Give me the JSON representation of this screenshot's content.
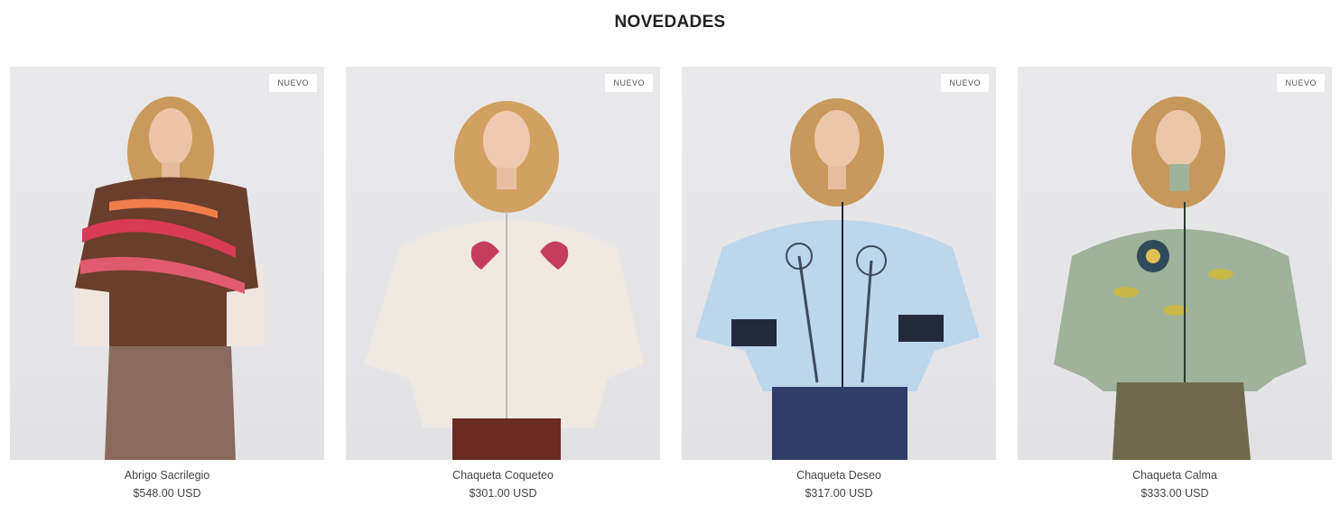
{
  "section": {
    "title": "NOVEDADES"
  },
  "products": [
    {
      "name": "Abrigo Sacrilegio",
      "price": "$548.00 USD",
      "badge": "NUEVO",
      "garment_color": "#6a3e2c",
      "accent_color": "#d93a55",
      "icon": "model-photo-coat"
    },
    {
      "name": "Chaqueta Coqueteo",
      "price": "$301.00 USD",
      "badge": "NUEVO",
      "garment_color": "#efe9e1",
      "accent_color": "#c43e5c",
      "icon": "model-photo-jacket"
    },
    {
      "name": "Chaqueta Deseo",
      "price": "$317.00 USD",
      "badge": "NUEVO",
      "garment_color": "#bcd6ec",
      "accent_color": "#3d4a5a",
      "icon": "model-photo-jacket"
    },
    {
      "name": "Chaqueta Calma",
      "price": "$333.00 USD",
      "badge": "NUEVO",
      "garment_color": "#9fb29a",
      "accent_color": "#c8b84a",
      "icon": "model-photo-jacket"
    }
  ]
}
